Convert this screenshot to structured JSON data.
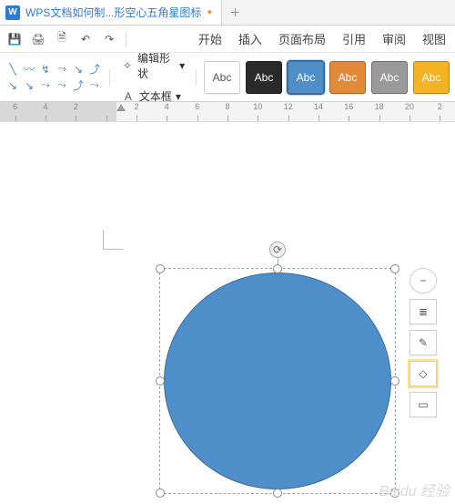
{
  "tab": {
    "title": "WPS文档如何制...形空心五角星图标",
    "dirty": "●"
  },
  "newtab_glyph": "＋",
  "qat": {
    "save_glyph": "💾",
    "print_glyph": "🖨",
    "preview_glyph": "🗎",
    "undo_glyph": "↶",
    "redo_glyph": "↷"
  },
  "menu": {
    "start": "开始",
    "insert": "插入",
    "page_layout": "页面布局",
    "references": "引用",
    "review": "审阅",
    "view": "视图"
  },
  "ribbon": {
    "edit_shape": "编辑形状",
    "edit_shape_caret": "▾",
    "text_box": "文本框",
    "text_box_caret": "▾",
    "text_box_glyph": "A",
    "swatch_label": "Abc",
    "shape_icons": [
      "╲",
      "〰",
      "↯",
      "⤳",
      "↘",
      "⤴",
      "↘",
      "↘",
      "⤳",
      "⤳",
      "⤴",
      "⤳"
    ]
  },
  "ruler": {
    "labels": [
      "6",
      "4",
      "2",
      "",
      "2",
      "4",
      "6",
      "8",
      "10",
      "12",
      "14",
      "16",
      "18",
      "20",
      "2"
    ]
  },
  "tools": {
    "minus": "−",
    "layout": "≣",
    "pen": "✎",
    "fill": "◇",
    "outline": "▭"
  },
  "rotate_glyph": "⟳",
  "watermark": "Baidu 经验"
}
